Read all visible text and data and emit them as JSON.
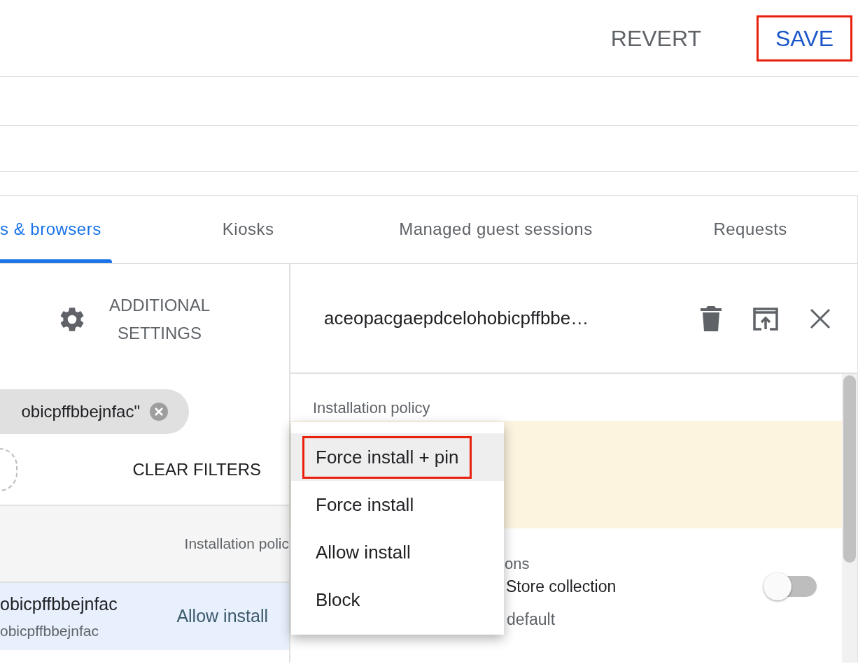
{
  "header": {
    "buttons": [
      {
        "label": "REVERT",
        "kind": "neutral",
        "outlined": false
      },
      {
        "label": "SAVE",
        "kind": "primary",
        "outlined": true
      }
    ]
  },
  "tabs": [
    {
      "label": "s & browsers",
      "selected": true
    },
    {
      "label": "Kiosks",
      "selected": false
    },
    {
      "label": "Managed guest sessions",
      "selected": false
    },
    {
      "label": "Requests",
      "selected": false
    }
  ],
  "left_panel": {
    "settings_button": "ADDITIONAL\nSETTINGS",
    "filter_chip": "obicpffbbejnfac\"",
    "clear_filters": "CLEAR FILTERS",
    "table": {
      "columns": [
        "Installation polic"
      ],
      "rows": [
        {
          "name": "obicpffbbejnfac",
          "id": "obicpffbbejnfac",
          "policy": "Allow install",
          "selected": true
        }
      ]
    }
  },
  "detail_panel": {
    "title": "aceopacgaepdcelohobicpffbbe…",
    "section_label": "Installation policy",
    "section_2_label": "ons",
    "setting": {
      "label": "Store collection",
      "note": "default",
      "on": false
    }
  },
  "menu": {
    "options": [
      {
        "label": "Force install + pin",
        "selected": true,
        "outlined": true
      },
      {
        "label": "Force install",
        "selected": false,
        "outlined": false
      },
      {
        "label": "Allow install",
        "selected": false,
        "outlined": false
      },
      {
        "label": "Block",
        "selected": false,
        "outlined": false
      }
    ]
  }
}
